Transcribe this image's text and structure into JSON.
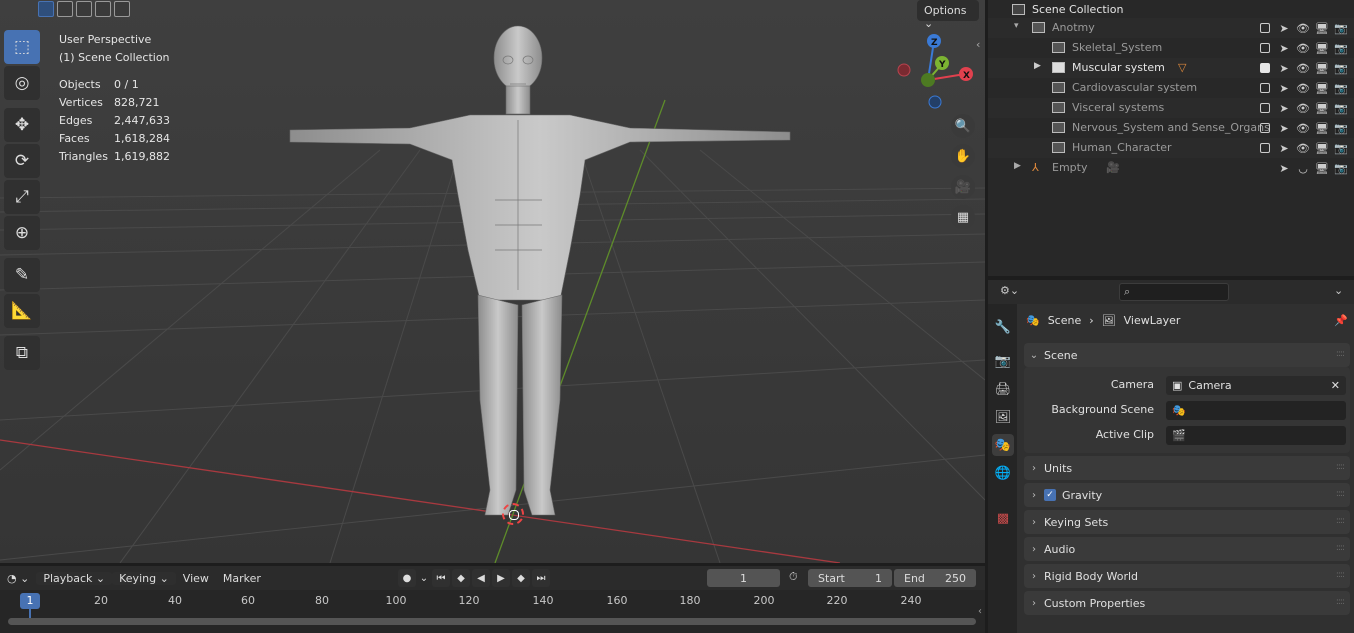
{
  "viewport": {
    "options_label": "Options",
    "perspective": "User Perspective",
    "collection": "(1) Scene Collection",
    "stats": [
      {
        "key": "Objects",
        "value": "0 / 1"
      },
      {
        "key": "Vertices",
        "value": "828,721"
      },
      {
        "key": "Edges",
        "value": "2,447,633"
      },
      {
        "key": "Faces",
        "value": "1,618,284"
      },
      {
        "key": "Triangles",
        "value": "1,619,882"
      }
    ],
    "gizmo": {
      "x": "X",
      "y": "Y",
      "z": "Z",
      "x_color": "#e0414e",
      "y_color": "#7cb432",
      "z_color": "#3a7ad6"
    }
  },
  "timeline": {
    "menus": [
      "Playback",
      "Keying",
      "View",
      "Marker"
    ],
    "current_frame": "1",
    "start_label": "Start",
    "start_value": "1",
    "end_label": "End",
    "end_value": "250",
    "ruler_current": "1",
    "ticks": [
      "20",
      "40",
      "60",
      "80",
      "100",
      "120",
      "140",
      "160",
      "180",
      "200",
      "220",
      "240"
    ]
  },
  "outliner": {
    "root": "Scene Collection",
    "collection": "Anotmy",
    "children": [
      "Skeletal_System",
      "Muscular system",
      "Cardiovascular system",
      "Visceral systems",
      "Nervous_System and Sense_Organs",
      "Human_Character"
    ],
    "empty": "Empty"
  },
  "properties": {
    "breadcrumb_scene": "Scene",
    "breadcrumb_layer": "ViewLayer",
    "scene_panel": "Scene",
    "camera_label": "Camera",
    "camera_value": "Camera",
    "background_scene_label": "Background Scene",
    "active_clip_label": "Active Clip",
    "panels": [
      "Units",
      "Gravity",
      "Keying Sets",
      "Audio",
      "Rigid Body World",
      "Custom Properties"
    ]
  },
  "accent_color": "#4772b3"
}
